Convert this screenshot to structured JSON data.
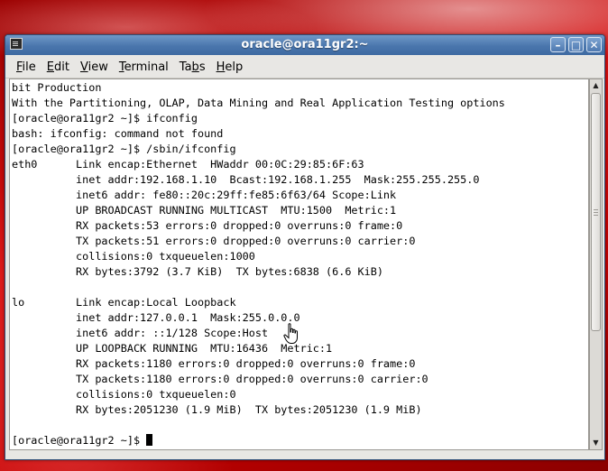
{
  "window": {
    "title": "oracle@ora11gr2:~"
  },
  "menu": [
    {
      "label": "File",
      "underline": "F",
      "rest": "ile"
    },
    {
      "label": "Edit",
      "underline": "E",
      "rest": "dit"
    },
    {
      "label": "View",
      "underline": "V",
      "rest": "iew"
    },
    {
      "label": "Terminal",
      "underline": "T",
      "rest": "erminal"
    },
    {
      "label": "Tabs",
      "pre": "Ta",
      "underline": "b",
      "rest": "s"
    },
    {
      "label": "Help",
      "underline": "H",
      "rest": "elp"
    }
  ],
  "terminal": {
    "lines": [
      "bit Production",
      "With the Partitioning, OLAP, Data Mining and Real Application Testing options",
      "[oracle@ora11gr2 ~]$ ifconfig",
      "bash: ifconfig: command not found",
      "[oracle@ora11gr2 ~]$ /sbin/ifconfig",
      "eth0      Link encap:Ethernet  HWaddr 00:0C:29:85:6F:63",
      "          inet addr:192.168.1.10  Bcast:192.168.1.255  Mask:255.255.255.0",
      "          inet6 addr: fe80::20c:29ff:fe85:6f63/64 Scope:Link",
      "          UP BROADCAST RUNNING MULTICAST  MTU:1500  Metric:1",
      "          RX packets:53 errors:0 dropped:0 overruns:0 frame:0",
      "          TX packets:51 errors:0 dropped:0 overruns:0 carrier:0",
      "          collisions:0 txqueuelen:1000",
      "          RX bytes:3792 (3.7 KiB)  TX bytes:6838 (6.6 KiB)",
      "",
      "lo        Link encap:Local Loopback",
      "          inet addr:127.0.0.1  Mask:255.0.0.0",
      "          inet6 addr: ::1/128 Scope:Host",
      "          UP LOOPBACK RUNNING  MTU:16436  Metric:1",
      "          RX packets:1180 errors:0 dropped:0 overruns:0 frame:0",
      "          TX packets:1180 errors:0 dropped:0 overruns:0 carrier:0",
      "          collisions:0 txqueuelen:0",
      "          RX bytes:2051230 (1.9 MiB)  TX bytes:2051230 (1.9 MiB)",
      "",
      "[oracle@ora11gr2 ~]$ "
    ]
  },
  "icons": {
    "app": "terminal-icon",
    "minimize": "minimize-icon",
    "maximize": "maximize-icon",
    "close": "close-icon",
    "pointer": "hand-pointer-icon"
  },
  "colors": {
    "titlebar": "#4a76ad",
    "desktop": "#c40000",
    "terminal_bg": "#ffffff",
    "terminal_fg": "#000000"
  }
}
